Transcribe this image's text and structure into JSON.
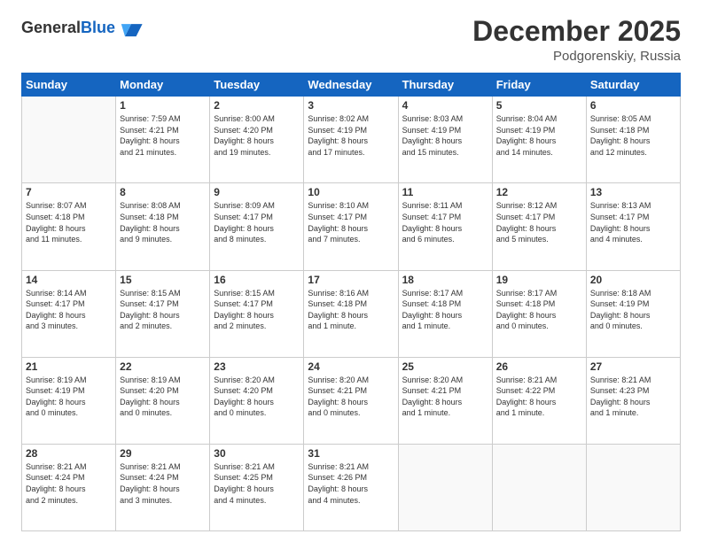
{
  "header": {
    "logo_general": "General",
    "logo_blue": "Blue",
    "month_title": "December 2025",
    "subtitle": "Podgorenskiy, Russia"
  },
  "days_of_week": [
    "Sunday",
    "Monday",
    "Tuesday",
    "Wednesday",
    "Thursday",
    "Friday",
    "Saturday"
  ],
  "weeks": [
    [
      {
        "day": "",
        "text": ""
      },
      {
        "day": "1",
        "text": "Sunrise: 7:59 AM\nSunset: 4:21 PM\nDaylight: 8 hours\nand 21 minutes."
      },
      {
        "day": "2",
        "text": "Sunrise: 8:00 AM\nSunset: 4:20 PM\nDaylight: 8 hours\nand 19 minutes."
      },
      {
        "day": "3",
        "text": "Sunrise: 8:02 AM\nSunset: 4:19 PM\nDaylight: 8 hours\nand 17 minutes."
      },
      {
        "day": "4",
        "text": "Sunrise: 8:03 AM\nSunset: 4:19 PM\nDaylight: 8 hours\nand 15 minutes."
      },
      {
        "day": "5",
        "text": "Sunrise: 8:04 AM\nSunset: 4:19 PM\nDaylight: 8 hours\nand 14 minutes."
      },
      {
        "day": "6",
        "text": "Sunrise: 8:05 AM\nSunset: 4:18 PM\nDaylight: 8 hours\nand 12 minutes."
      }
    ],
    [
      {
        "day": "7",
        "text": "Sunrise: 8:07 AM\nSunset: 4:18 PM\nDaylight: 8 hours\nand 11 minutes."
      },
      {
        "day": "8",
        "text": "Sunrise: 8:08 AM\nSunset: 4:18 PM\nDaylight: 8 hours\nand 9 minutes."
      },
      {
        "day": "9",
        "text": "Sunrise: 8:09 AM\nSunset: 4:17 PM\nDaylight: 8 hours\nand 8 minutes."
      },
      {
        "day": "10",
        "text": "Sunrise: 8:10 AM\nSunset: 4:17 PM\nDaylight: 8 hours\nand 7 minutes."
      },
      {
        "day": "11",
        "text": "Sunrise: 8:11 AM\nSunset: 4:17 PM\nDaylight: 8 hours\nand 6 minutes."
      },
      {
        "day": "12",
        "text": "Sunrise: 8:12 AM\nSunset: 4:17 PM\nDaylight: 8 hours\nand 5 minutes."
      },
      {
        "day": "13",
        "text": "Sunrise: 8:13 AM\nSunset: 4:17 PM\nDaylight: 8 hours\nand 4 minutes."
      }
    ],
    [
      {
        "day": "14",
        "text": "Sunrise: 8:14 AM\nSunset: 4:17 PM\nDaylight: 8 hours\nand 3 minutes."
      },
      {
        "day": "15",
        "text": "Sunrise: 8:15 AM\nSunset: 4:17 PM\nDaylight: 8 hours\nand 2 minutes."
      },
      {
        "day": "16",
        "text": "Sunrise: 8:15 AM\nSunset: 4:17 PM\nDaylight: 8 hours\nand 2 minutes."
      },
      {
        "day": "17",
        "text": "Sunrise: 8:16 AM\nSunset: 4:18 PM\nDaylight: 8 hours\nand 1 minute."
      },
      {
        "day": "18",
        "text": "Sunrise: 8:17 AM\nSunset: 4:18 PM\nDaylight: 8 hours\nand 1 minute."
      },
      {
        "day": "19",
        "text": "Sunrise: 8:17 AM\nSunset: 4:18 PM\nDaylight: 8 hours\nand 0 minutes."
      },
      {
        "day": "20",
        "text": "Sunrise: 8:18 AM\nSunset: 4:19 PM\nDaylight: 8 hours\nand 0 minutes."
      }
    ],
    [
      {
        "day": "21",
        "text": "Sunrise: 8:19 AM\nSunset: 4:19 PM\nDaylight: 8 hours\nand 0 minutes."
      },
      {
        "day": "22",
        "text": "Sunrise: 8:19 AM\nSunset: 4:20 PM\nDaylight: 8 hours\nand 0 minutes."
      },
      {
        "day": "23",
        "text": "Sunrise: 8:20 AM\nSunset: 4:20 PM\nDaylight: 8 hours\nand 0 minutes."
      },
      {
        "day": "24",
        "text": "Sunrise: 8:20 AM\nSunset: 4:21 PM\nDaylight: 8 hours\nand 0 minutes."
      },
      {
        "day": "25",
        "text": "Sunrise: 8:20 AM\nSunset: 4:21 PM\nDaylight: 8 hours\nand 1 minute."
      },
      {
        "day": "26",
        "text": "Sunrise: 8:21 AM\nSunset: 4:22 PM\nDaylight: 8 hours\nand 1 minute."
      },
      {
        "day": "27",
        "text": "Sunrise: 8:21 AM\nSunset: 4:23 PM\nDaylight: 8 hours\nand 1 minute."
      }
    ],
    [
      {
        "day": "28",
        "text": "Sunrise: 8:21 AM\nSunset: 4:24 PM\nDaylight: 8 hours\nand 2 minutes."
      },
      {
        "day": "29",
        "text": "Sunrise: 8:21 AM\nSunset: 4:24 PM\nDaylight: 8 hours\nand 3 minutes."
      },
      {
        "day": "30",
        "text": "Sunrise: 8:21 AM\nSunset: 4:25 PM\nDaylight: 8 hours\nand 4 minutes."
      },
      {
        "day": "31",
        "text": "Sunrise: 8:21 AM\nSunset: 4:26 PM\nDaylight: 8 hours\nand 4 minutes."
      },
      {
        "day": "",
        "text": ""
      },
      {
        "day": "",
        "text": ""
      },
      {
        "day": "",
        "text": ""
      }
    ]
  ]
}
